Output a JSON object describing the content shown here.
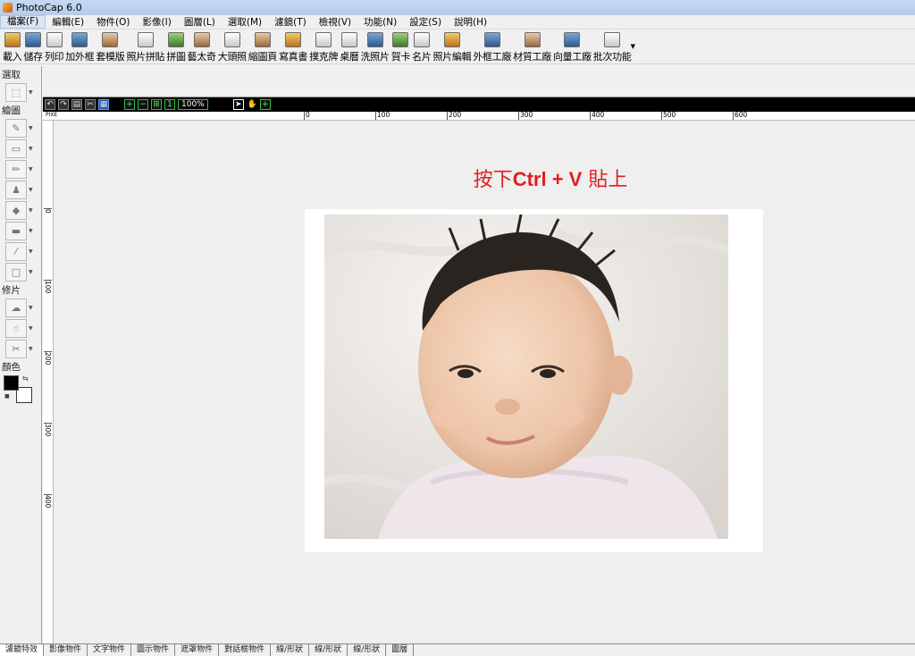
{
  "window": {
    "title": "PhotoCap 6.0"
  },
  "menu": [
    {
      "label": "檔案(F)",
      "name": "menu-file"
    },
    {
      "label": "編輯(E)",
      "name": "menu-edit"
    },
    {
      "label": "物件(O)",
      "name": "menu-object"
    },
    {
      "label": "影像(I)",
      "name": "menu-image"
    },
    {
      "label": "圖層(L)",
      "name": "menu-layer"
    },
    {
      "label": "選取(M)",
      "name": "menu-select"
    },
    {
      "label": "濾鏡(T)",
      "name": "menu-filter"
    },
    {
      "label": "檢視(V)",
      "name": "menu-view"
    },
    {
      "label": "功能(N)",
      "name": "menu-function"
    },
    {
      "label": "設定(S)",
      "name": "menu-settings"
    },
    {
      "label": "說明(H)",
      "name": "menu-help"
    }
  ],
  "toolbar": [
    {
      "label": "載入",
      "icon": "open-folder-icon",
      "style": "a"
    },
    {
      "label": "儲存",
      "icon": "save-icon",
      "style": "b"
    },
    {
      "label": "列印",
      "icon": "print-icon",
      "style": "e"
    },
    {
      "label": "加外框",
      "icon": "frame-icon",
      "style": "b"
    },
    {
      "label": "套模版",
      "icon": "template-icon",
      "style": "d"
    },
    {
      "label": "照片拼貼",
      "icon": "collage-icon",
      "style": "e"
    },
    {
      "label": "拼圖",
      "icon": "puzzle-icon",
      "style": "c"
    },
    {
      "label": "藝太奇",
      "icon": "montage-icon",
      "style": "d"
    },
    {
      "label": "大頭照",
      "icon": "id-photo-icon",
      "style": "e"
    },
    {
      "label": "縮圖頁",
      "icon": "thumbnail-page-icon",
      "style": "d"
    },
    {
      "label": "寫真書",
      "icon": "photo-book-icon",
      "style": "a"
    },
    {
      "label": "撲克牌",
      "icon": "poker-card-icon",
      "style": "e"
    },
    {
      "label": "桌曆",
      "icon": "desk-calendar-icon",
      "style": "e"
    },
    {
      "label": "洗照片",
      "icon": "print-photo-icon",
      "style": "b"
    },
    {
      "label": "賀卡",
      "icon": "greeting-card-icon",
      "style": "c"
    },
    {
      "label": "名片",
      "icon": "business-card-icon",
      "style": "e"
    },
    {
      "label": "照片編輯",
      "icon": "photo-edit-icon",
      "style": "a"
    },
    {
      "label": "外框工廠",
      "icon": "frame-factory-icon",
      "style": "b"
    },
    {
      "label": "材質工廠",
      "icon": "texture-factory-icon",
      "style": "d"
    },
    {
      "label": "向量工廠",
      "icon": "vector-factory-icon",
      "style": "b"
    },
    {
      "label": "批次功能",
      "icon": "batch-icon",
      "style": "e"
    }
  ],
  "left_panel": {
    "sections": {
      "select": "選取",
      "draw": "繪圖",
      "retouch": "修片",
      "color": "顏色"
    },
    "select_tools": [
      {
        "icon": "marquee-icon"
      }
    ],
    "draw_tools": [
      {
        "icon": "brush-icon"
      },
      {
        "icon": "eraser-icon"
      },
      {
        "icon": "pencil-icon"
      },
      {
        "icon": "clone-stamp-icon"
      },
      {
        "icon": "fill-bucket-icon"
      },
      {
        "icon": "rectangle-fill-icon"
      },
      {
        "icon": "eyedropper-icon"
      },
      {
        "icon": "rectangle-shape-icon"
      }
    ],
    "retouch_tools": [
      {
        "icon": "blur-icon"
      },
      {
        "icon": "smudge-icon"
      },
      {
        "icon": "red-eye-icon"
      }
    ],
    "foreground_color": "#000000",
    "background_color": "#ffffff"
  },
  "image_toolbar": {
    "zoom": "100%"
  },
  "ruler": {
    "unit": "PIXE",
    "h_ticks": [
      "0",
      "100",
      "200",
      "300",
      "400",
      "500",
      "600"
    ],
    "v_ticks": [
      "0",
      "100",
      "200",
      "300",
      "400"
    ]
  },
  "canvas": {
    "paste_hint_prefix": "按下",
    "paste_hint_keys": "Ctrl + V",
    "paste_hint_suffix": " 貼上",
    "accent": "#e41d1d"
  },
  "status_tabs": [
    "濾鏡特效",
    "影像物件",
    "文字物件",
    "圖示物件",
    "遮罩物件",
    "對話框物件",
    "線/形狀",
    "線/形狀",
    "線/形狀",
    "圖層"
  ]
}
